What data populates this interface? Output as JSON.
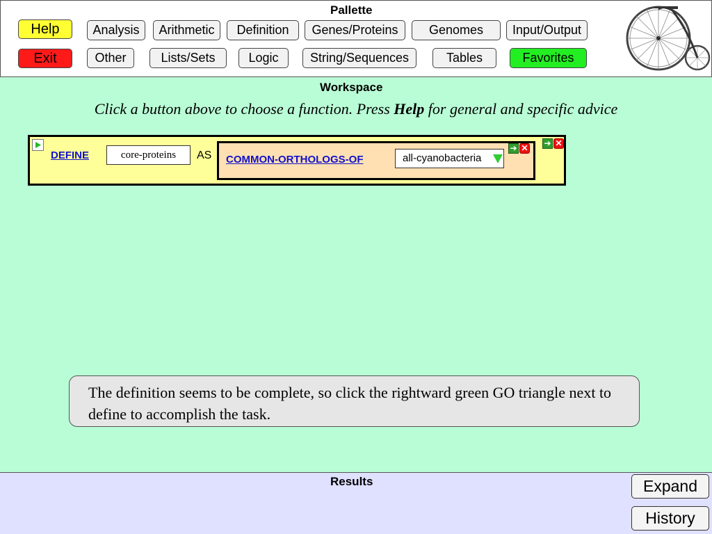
{
  "palette": {
    "title": "Pallette",
    "help_label": "Help",
    "exit_label": "Exit",
    "row1": [
      "Analysis",
      "Arithmetic",
      "Definition",
      "Genes/Proteins",
      "Genomes",
      "Input/Output"
    ],
    "row2": [
      "Other",
      "Lists/Sets",
      "Logic",
      "String/Sequences",
      "Tables",
      "Favorites"
    ]
  },
  "workspace": {
    "title": "Workspace",
    "instruction_prefix": "Click a button above to choose a function. Press ",
    "instruction_bold": "Help",
    "instruction_suffix": " for general and specific advice",
    "define_label": "DEFINE",
    "define_name_value": "core-proteins",
    "as_label": "AS",
    "function_label": "COMMON-ORTHOLOGS-OF",
    "function_arg_value": "all-cyanobacteria",
    "note": "The definition seems to be complete, so click the rightward green GO triangle next to define to accomplish the task."
  },
  "results": {
    "title": "Results",
    "expand_label": "Expand",
    "history_label": "History"
  },
  "colors": {
    "workspace_bg": "#b9fdd6",
    "results_bg": "#e0e0ff",
    "help": "#ffff33",
    "exit": "#ff1a1a",
    "favorites": "#22ee22",
    "define_box": "#ffff99",
    "nested_box": "#ffe0b3",
    "link": "#1010cc"
  }
}
